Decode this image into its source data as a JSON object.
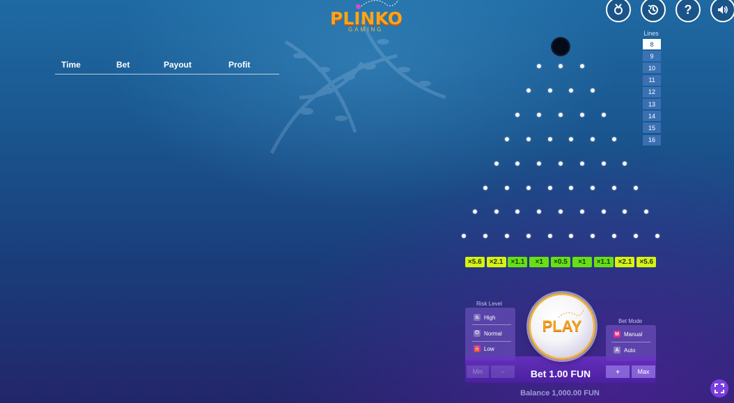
{
  "logo": {
    "word": "PLINKO",
    "sub": "GAMING"
  },
  "top_icons": [
    {
      "name": "medal-icon",
      "glyph": "🏅"
    },
    {
      "name": "history-icon",
      "glyph": "↻"
    },
    {
      "name": "help-icon",
      "glyph": "?"
    },
    {
      "name": "sound-icon",
      "glyph": "🔊"
    }
  ],
  "history": {
    "headers": [
      "Time",
      "Bet",
      "Payout",
      "Profit"
    ]
  },
  "lines": {
    "title": "Lines",
    "options": [
      "8",
      "9",
      "10",
      "11",
      "12",
      "13",
      "14",
      "15",
      "16"
    ],
    "selected": "8"
  },
  "multipliers": [
    "×5.6",
    "×2.1",
    "×1.1",
    "×1",
    "×0.5",
    "×1",
    "×1.1",
    "×2.1",
    "×5.6"
  ],
  "risk": {
    "title": "Risk Level",
    "options": [
      "High",
      "Normal",
      "Low"
    ],
    "selected": "Low"
  },
  "play_label": "PLAY",
  "bet_mode": {
    "title": "Bet Mode",
    "options": [
      {
        "key": "M",
        "label": "Manual"
      },
      {
        "key": "A",
        "label": "Auto"
      }
    ],
    "selected": "Manual"
  },
  "bet": {
    "min_label": "Min",
    "minus_label": "–",
    "plus_label": "+",
    "max_label": "Max",
    "text": "Bet 1.00 FUN"
  },
  "balance_text": "Balance 1,000.00 FUN",
  "colors": {
    "accent_orange": "#f7a51c",
    "panel_purple": "#7a5ac8",
    "mult_green": "#66e014",
    "mult_yellow": "#d8f212"
  }
}
